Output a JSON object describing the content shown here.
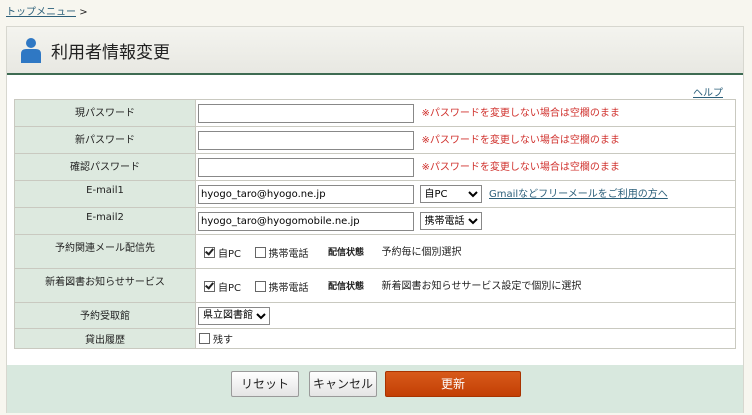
{
  "breadcrumb": {
    "top_menu": "トップメニュー",
    "separator": ">"
  },
  "page": {
    "title": "利用者情報変更",
    "help": "ヘルプ",
    "icon": "user-icon"
  },
  "rows": {
    "current_password": {
      "label": "現パスワード",
      "value": "",
      "note": "※パスワードを変更しない場合は空欄のまま"
    },
    "new_password": {
      "label": "新パスワード",
      "value": "",
      "note": "※パスワードを変更しない場合は空欄のまま"
    },
    "confirm_password": {
      "label": "確認パスワード",
      "value": "",
      "note": "※パスワードを変更しない場合は空欄のまま"
    },
    "email1": {
      "label": "E-mail1",
      "value": "hyogo_taro@hyogo.ne.jp",
      "type": "自PC",
      "link": "Gmailなどフリーメールをご利用の方へ"
    },
    "email2": {
      "label": "E-mail2",
      "value": "hyogo_taro@hyogomobile.ne.jp",
      "type": "携帯電話"
    },
    "reservation_mail": {
      "label": "予約関連メール配信先",
      "opt_pc": "自PC",
      "opt_pc_checked": true,
      "opt_mobile": "携帯電話",
      "opt_mobile_checked": false,
      "status_label": "配信状態",
      "status_value": "予約毎に個別選択"
    },
    "new_books": {
      "label": "新着図書お知らせサービス",
      "opt_pc": "自PC",
      "opt_pc_checked": true,
      "opt_mobile": "携帯電話",
      "opt_mobile_checked": false,
      "status_label": "配信状態",
      "status_value": "新着図書お知らせサービス設定で個別に選択"
    },
    "pickup_library": {
      "label": "予約受取館",
      "value": "県立図書館"
    },
    "loan_history": {
      "label": "貸出履歴",
      "option": "残す",
      "checked": false
    }
  },
  "buttons": {
    "reset": "リセット",
    "cancel": "キャンセル",
    "update": "更新"
  },
  "colors": {
    "label_bg": "#dde9df",
    "warning": "#d0312d",
    "link": "#2b5f7a",
    "primary_button": "#c94a0c",
    "footer_bg": "#d8e8de",
    "title_rule": "#3e6b52"
  }
}
